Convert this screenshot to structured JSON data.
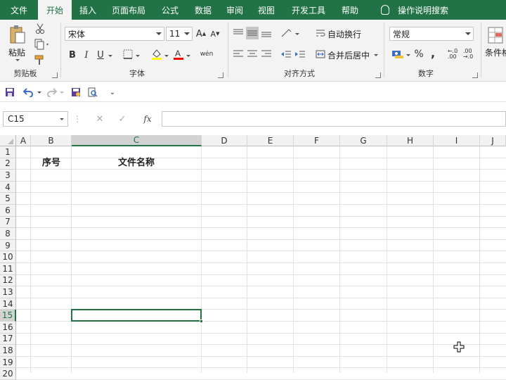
{
  "tabs": [
    {
      "label": "文件"
    },
    {
      "label": "开始"
    },
    {
      "label": "插入"
    },
    {
      "label": "页面布局"
    },
    {
      "label": "公式"
    },
    {
      "label": "数据"
    },
    {
      "label": "审阅"
    },
    {
      "label": "视图"
    },
    {
      "label": "开发工具"
    },
    {
      "label": "帮助"
    }
  ],
  "tell_me": "操作说明搜索",
  "ribbon": {
    "clipboard": {
      "paste_label": "粘贴",
      "group_label": "剪贴板"
    },
    "font": {
      "font_name": "宋体",
      "font_size": "11",
      "group_label": "字体",
      "bold": "B",
      "italic": "I",
      "underline": "U"
    },
    "alignment": {
      "wrap_text": "自动换行",
      "merge_center": "合并后居中",
      "group_label": "对齐方式"
    },
    "number": {
      "format": "常规",
      "group_label": "数字",
      "percent": "%",
      "comma": ","
    },
    "styles": {
      "conditional_format": "条件格"
    }
  },
  "name_box": "C15",
  "formula_bar": {
    "fx": "fx",
    "value": ""
  },
  "columns": [
    "A",
    "B",
    "C",
    "D",
    "E",
    "F",
    "G",
    "H",
    "I",
    "J"
  ],
  "rows": [
    "1",
    "2",
    "3",
    "4",
    "5",
    "6",
    "7",
    "8",
    "9",
    "10",
    "11",
    "12",
    "13",
    "14",
    "15",
    "16",
    "17",
    "18",
    "19",
    "20"
  ],
  "cells": {
    "B2": "序号",
    "C2": "文件名称"
  },
  "selected_cell": "C15",
  "colors": {
    "accent": "#217346",
    "font_color": "#ff0000"
  }
}
